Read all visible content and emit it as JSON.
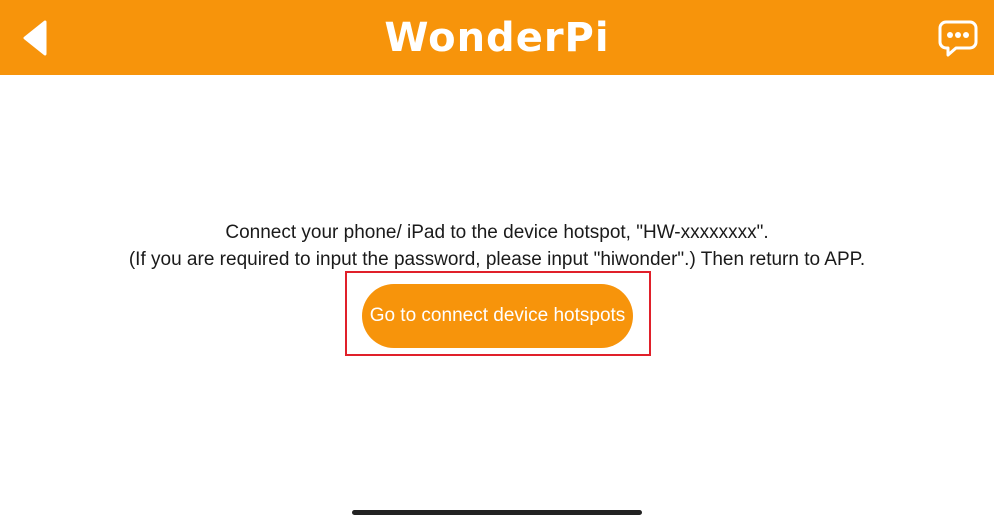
{
  "header": {
    "logo_text": "WonderPi",
    "back_icon": "back-arrow-icon",
    "chat_icon": "chat-bubble-icon"
  },
  "main": {
    "instruction_line1": "Connect your phone/ iPad to the device hotspot, \"HW-xxxxxxxx\".",
    "instruction_line2": "(If you are required to input the password, please input \"hiwonder\".) Then return to APP.",
    "connect_button_label": "Go to connect device hotspots"
  },
  "colors": {
    "accent": "#f7940b",
    "highlight": "#e0202a"
  }
}
